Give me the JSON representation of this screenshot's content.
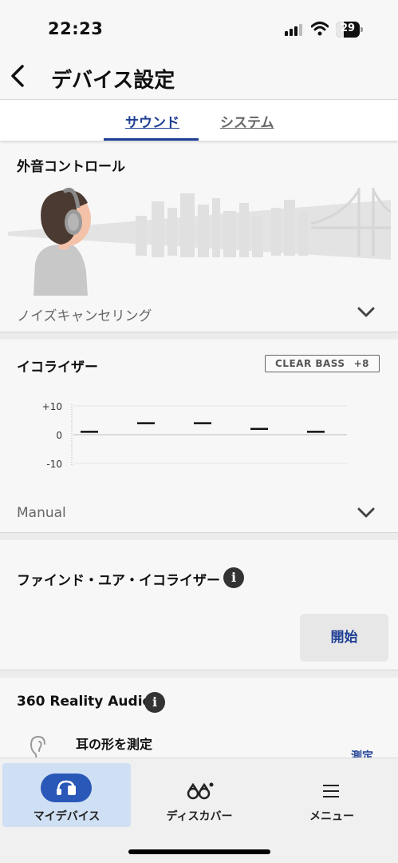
{
  "status_bar": {
    "time": "22:23",
    "battery": "29"
  },
  "header": {
    "title": "デバイス設定",
    "back_icon": "chevron-left-icon"
  },
  "tabs": [
    {
      "label": "サウンド",
      "active": true
    },
    {
      "label": "システム",
      "active": false
    }
  ],
  "ambient": {
    "title": "外音コントロール",
    "mode": "ノイズキャンセリング"
  },
  "equalizer": {
    "title": "イコライザー",
    "clear_bass_label": "CLEAR BASS",
    "clear_bass_value": "+8",
    "preset": "Manual",
    "y_ticks": [
      "+10",
      "0",
      "-10"
    ],
    "bands": [
      1,
      4,
      4,
      2,
      1
    ]
  },
  "find_eq": {
    "title": "ファインド・ユア・イコライザー",
    "start_label": "開始"
  },
  "reality360": {
    "title": "360 Reality Audio",
    "ear_title": "耳の形を測定",
    "measure_label": "測定"
  },
  "bottom_nav": [
    {
      "label": "マイデバイス",
      "icon": "headphones-icon",
      "active": true
    },
    {
      "label": "ディスカバー",
      "icon": "binoculars-icon",
      "active": false
    },
    {
      "label": "メニュー",
      "icon": "hamburger-menu-icon",
      "active": false
    }
  ],
  "colors": {
    "accent": "#1e3f93",
    "nav_active_bg": "#cfe0f4",
    "nav_pill": "#2a58b8"
  }
}
